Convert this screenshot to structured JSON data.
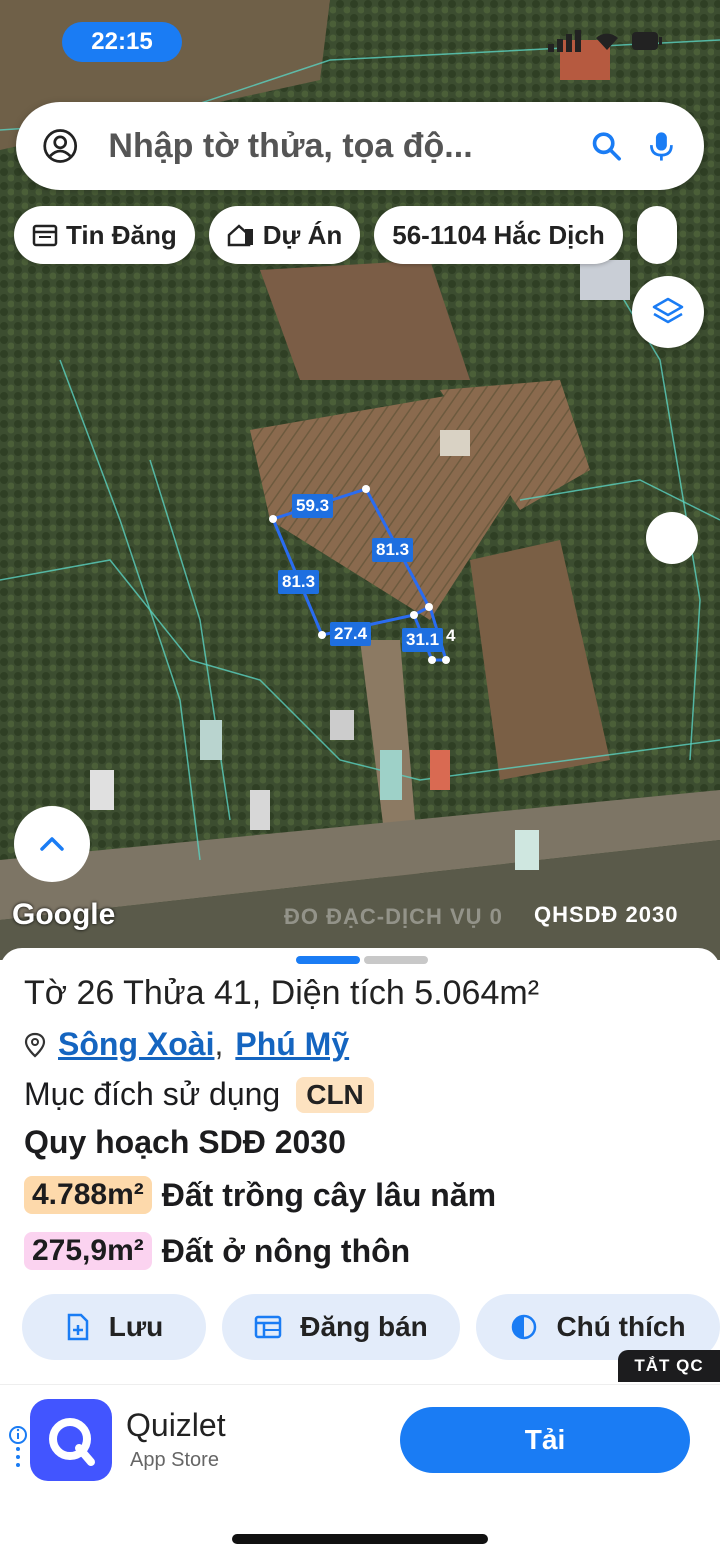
{
  "status_bar": {
    "time": "22:15"
  },
  "search": {
    "placeholder": "Nhập tờ thửa, tọa độ..."
  },
  "chips": [
    {
      "label": "Tin Đăng",
      "icon": "calendar-icon"
    },
    {
      "label": "Dự Án",
      "icon": "building-icon"
    },
    {
      "label": "56-1104 Hắc Dịch",
      "icon": ""
    }
  ],
  "map": {
    "plot_edges": [
      "59.3",
      "81.3",
      "81.3",
      "27.4",
      "31.1",
      "4"
    ],
    "google_label": "Google",
    "watermark": "ĐO ĐẠC-DỊCH VỤ 0",
    "overlay_label": "QHSDĐ 2030"
  },
  "parcel": {
    "title": "Tờ 26 Thửa 41, Diện tích 5.064m²",
    "ward": "Sông Xoài",
    "city": "Phú Mỹ",
    "purpose_label": "Mục đích sử dụng",
    "purpose_code": "CLN",
    "plan_title": "Quy hoạch SDĐ 2030",
    "zones": [
      {
        "area": "4.788m²",
        "label": "Đất trồng cây lâu năm",
        "color": "#fdd9ab"
      },
      {
        "area": "275,9m²",
        "label": "Đất ở nông thôn",
        "color": "#fbd3f0"
      }
    ]
  },
  "actions": {
    "save": "Lưu",
    "post": "Đăng bán",
    "legend": "Chú thích"
  },
  "ad": {
    "hide_label": "TẮT QC",
    "app_name": "Quizlet",
    "store": "App Store",
    "install": "Tải"
  },
  "colors": {
    "accent": "#1a7cf4",
    "plot_line": "#2a6cf0"
  }
}
